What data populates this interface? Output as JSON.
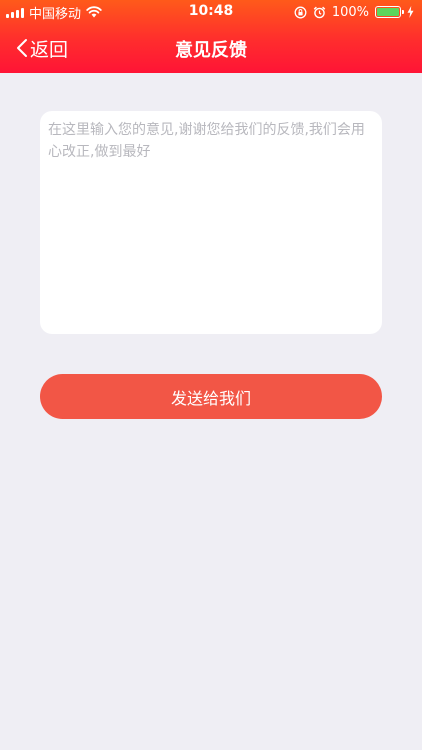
{
  "status_bar": {
    "carrier": "中国移动",
    "time": "10:48",
    "battery": "100%",
    "battery_level": 1.0,
    "icons": [
      "signal-icon",
      "wifi-icon",
      "orientation-lock-icon",
      "alarm-icon",
      "battery-icon",
      "charging-icon"
    ]
  },
  "navbar": {
    "back_label": "返回",
    "title": "意见反馈"
  },
  "feedback": {
    "value": "",
    "placeholder": "在这里输入您的意见,谢谢您给我们的反馈,我们会用心改正,做到最好"
  },
  "actions": {
    "send_label": "发送给我们"
  },
  "colors": {
    "header_top": "#ff5a1a",
    "header_bottom": "#ff1436",
    "background": "#efeef4",
    "button": "#f25646",
    "battery_fill": "#5cd65c"
  }
}
